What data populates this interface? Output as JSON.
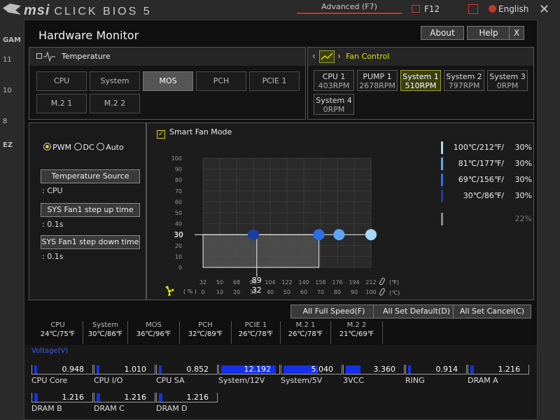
{
  "bios": {
    "brand": "msi",
    "product": "CLICK BIOS 5",
    "advanced_tab": "Advanced (F7)",
    "f12_label": "F12",
    "language": "English",
    "close": "✕"
  },
  "background_left_numbers": [
    "GAM",
    "11",
    "10",
    "8",
    "EZ"
  ],
  "window": {
    "title": "Hardware Monitor",
    "about": "About",
    "help": "Help",
    "close": "X"
  },
  "temperature": {
    "header": "Temperature",
    "sensors": [
      {
        "label": "CPU",
        "active": false
      },
      {
        "label": "System",
        "active": false
      },
      {
        "label": "MOS",
        "active": true
      },
      {
        "label": "PCH",
        "active": false
      },
      {
        "label": "PCIE 1",
        "active": false
      },
      {
        "label": "M.2 1",
        "active": false
      },
      {
        "label": "M.2 2",
        "active": false
      }
    ]
  },
  "fan_control": {
    "header": "Fan Control",
    "fans": [
      {
        "name": "CPU 1",
        "rpm": "403RPM",
        "active": false
      },
      {
        "name": "PUMP 1",
        "rpm": "2678RPM",
        "active": false
      },
      {
        "name": "System 1",
        "rpm": "510RPM",
        "active": true
      },
      {
        "name": "System 2",
        "rpm": "797RPM",
        "active": false
      },
      {
        "name": "System 3",
        "rpm": "0RPM",
        "active": false
      },
      {
        "name": "System 4",
        "rpm": "0RPM",
        "active": false
      }
    ]
  },
  "mode": {
    "pwm": "PWM",
    "dc": "DC",
    "auto": "Auto",
    "selected": "PWM"
  },
  "temperature_source": {
    "button": "Temperature Source",
    "value": ": CPU"
  },
  "step_up": {
    "button": "SYS Fan1 step up time",
    "value": ": 0.1s"
  },
  "step_down": {
    "button": "SYS Fan1 step down time",
    "value": ": 0.1s"
  },
  "smart_fan": {
    "label": "Smart Fan Mode",
    "checked": true,
    "check_glyph": "✓"
  },
  "chart_data": {
    "type": "line",
    "y_ticks": [
      "100",
      "90",
      "80",
      "70",
      "60",
      "50",
      "40",
      "30",
      "20",
      "10",
      "0"
    ],
    "x_ticks_f": [
      "32",
      "50",
      "68",
      "86",
      "104",
      "122",
      "140",
      "158",
      "176",
      "194",
      "212"
    ],
    "x_ticks_c": [
      "0",
      "10",
      "20",
      "30",
      "40",
      "50",
      "60",
      "70",
      "80",
      "90",
      "100"
    ],
    "current_temp_f": "89",
    "current_temp_c": "32",
    "current_speed": "30",
    "percent_label": "( % )",
    "f_unit": "(℉)",
    "c_unit": "(℃)",
    "xlim": [
      0,
      100
    ],
    "ylim": [
      0,
      100
    ],
    "current_point": {
      "temp_c": 32,
      "speed": 30
    },
    "points": [
      {
        "temp_c": 30,
        "speed": 30,
        "color": "#1a3f9e"
      },
      {
        "temp_c": 69,
        "speed": 30,
        "color": "#2b6fe6"
      },
      {
        "temp_c": 81,
        "speed": 30,
        "color": "#5aa8f5"
      },
      {
        "temp_c": 100,
        "speed": 30,
        "color": "#a8d8ff"
      }
    ]
  },
  "legend": [
    {
      "temp": "100℃/212℉/",
      "pct": "30%",
      "color": "#a8d8ff"
    },
    {
      "temp": "81℃/177℉/",
      "pct": "30%",
      "color": "#5aa8f5"
    },
    {
      "temp": "69℃/156℉/",
      "pct": "30%",
      "color": "#2b6fe6"
    },
    {
      "temp": "30℃/86℉/",
      "pct": "30%",
      "color": "#1a3f9e"
    },
    {
      "temp": "",
      "pct": "22%",
      "color": "#888888"
    }
  ],
  "actions": {
    "full_speed": "All Full Speed(F)",
    "set_default": "All Set Default(D)",
    "set_cancel": "All Set Cancel(C)"
  },
  "summary": [
    {
      "name": "CPU",
      "value": "24℃/75℉"
    },
    {
      "name": "System",
      "value": "30℃/86℉"
    },
    {
      "name": "MOS",
      "value": "36℃/96℉"
    },
    {
      "name": "PCH",
      "value": "32℃/89℉"
    },
    {
      "name": "PCIE 1",
      "value": "26℃/78℉"
    },
    {
      "name": "M.2 1",
      "value": "26℃/78℉"
    },
    {
      "name": "M.2 2",
      "value": "21℃/69℉"
    }
  ],
  "voltage": {
    "header": "Voltage(V)",
    "items": [
      {
        "name": "CPU Core",
        "value": "0.948",
        "fill": 0.04
      },
      {
        "name": "CPU I/O",
        "value": "1.010",
        "fill": 0.05
      },
      {
        "name": "CPU SA",
        "value": "0.852",
        "fill": 0.04
      },
      {
        "name": "System/12V",
        "value": "12.192",
        "fill": 0.95
      },
      {
        "name": "System/5V",
        "value": "5.040",
        "fill": 0.6
      },
      {
        "name": "3VCC",
        "value": "3.360",
        "fill": 0.25
      },
      {
        "name": "RING",
        "value": "0.914",
        "fill": 0.04
      },
      {
        "name": "DRAM A",
        "value": "1.216",
        "fill": 0.06
      },
      {
        "name": "DRAM B",
        "value": "1.216",
        "fill": 0.06
      },
      {
        "name": "DRAM C",
        "value": "1.216",
        "fill": 0.06
      },
      {
        "name": "DRAM D",
        "value": "1.216",
        "fill": 0.06
      }
    ]
  }
}
